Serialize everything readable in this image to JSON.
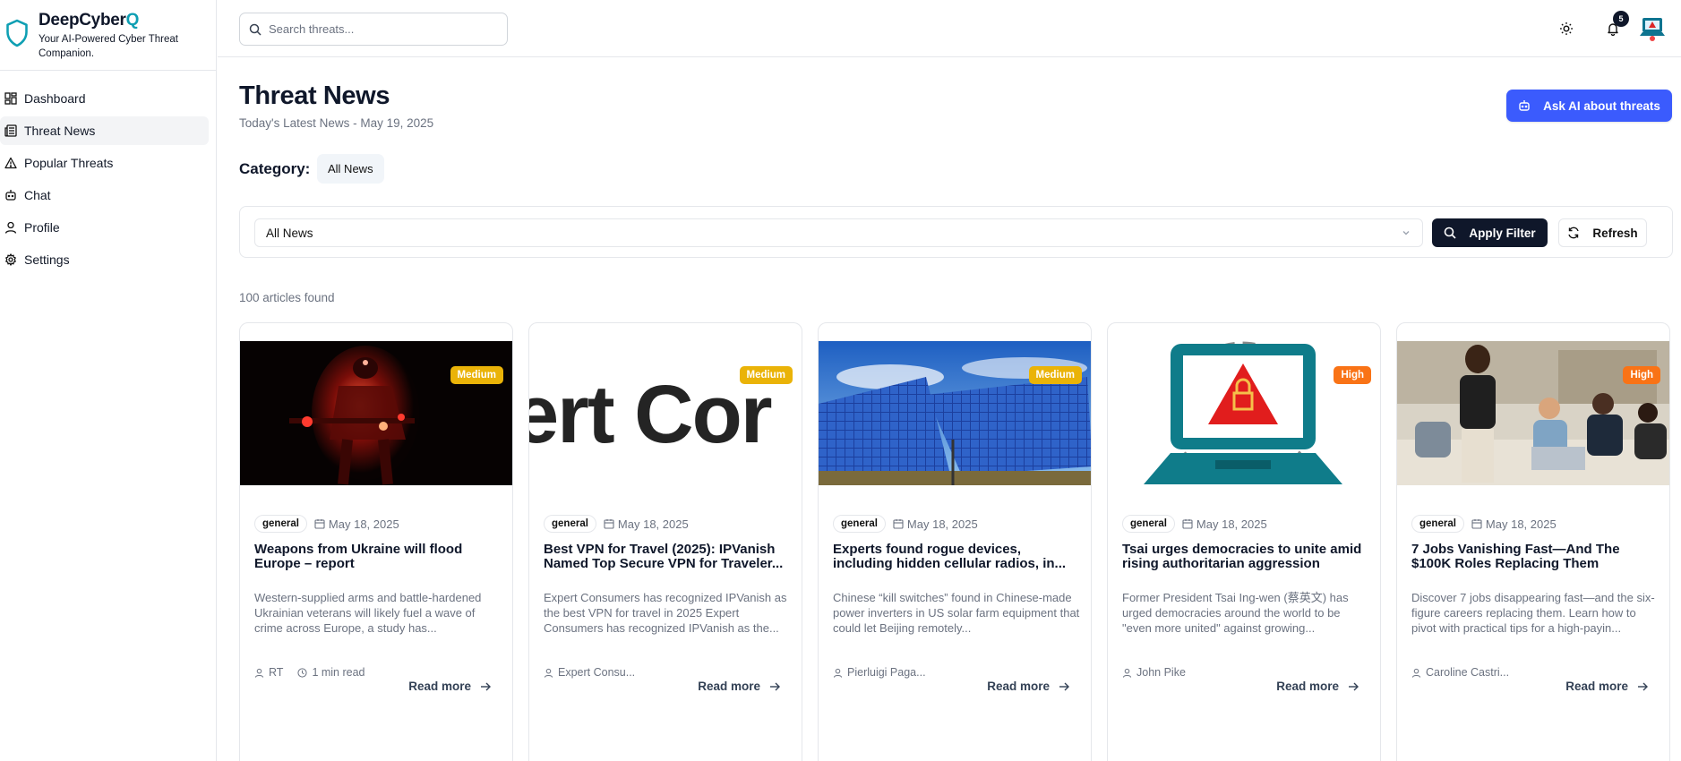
{
  "brand": {
    "name_main": "DeepCyber",
    "name_accent": "Q",
    "tagline": "Your AI-Powered Cyber Threat Companion.",
    "accent_color": "#0e9fb3"
  },
  "sidebar": {
    "items": [
      {
        "label": "Dashboard",
        "icon": "dashboard-icon"
      },
      {
        "label": "Threat News",
        "icon": "newspaper-icon",
        "active": true
      },
      {
        "label": "Popular Threats",
        "icon": "warning-triangle-icon"
      },
      {
        "label": "Chat",
        "icon": "bot-icon"
      },
      {
        "label": "Profile",
        "icon": "user-icon"
      },
      {
        "label": "Settings",
        "icon": "gear-icon"
      }
    ]
  },
  "header": {
    "search_placeholder": "Search threats...",
    "notification_count": "5"
  },
  "page": {
    "title": "Threat News",
    "subtitle": "Today's Latest News - May 19, 2025",
    "ask_ai_label": "Ask AI about threats",
    "category_label": "Category:",
    "category_chip": "All News"
  },
  "filter": {
    "selected": "All News",
    "apply_label": "Apply Filter",
    "refresh_label": "Refresh"
  },
  "results": {
    "count_text": "100 articles found"
  },
  "colors": {
    "primary_button": "#3b5bfd",
    "dark_button": "#0f172a",
    "medium": "#eab308",
    "high": "#f97316"
  },
  "articles": [
    {
      "severity": "Medium",
      "tag": "general",
      "date": "May 18, 2025",
      "title": "Weapons from Ukraine will flood Europe – report",
      "description": "Western-supplied arms and battle-hardened Ukrainian veterans will likely fuel a wave of crime across Europe, a study has...",
      "author": "RT",
      "read_time": "1 min read",
      "read_more": "Read more"
    },
    {
      "severity": "Medium",
      "tag": "general",
      "date": "May 18, 2025",
      "title": "Best VPN for Travel (2025): IPVanish Named Top Secure VPN for Traveler...",
      "description": "Expert Consumers has recognized IPVanish as the best VPN for travel in 2025 Expert Consumers has recognized IPVanish as the...",
      "author": "Expert Consu...",
      "read_more": "Read more",
      "image_text": "ert Cor"
    },
    {
      "severity": "Medium",
      "tag": "general",
      "date": "May 18, 2025",
      "title": "Experts found rogue devices, including hidden cellular radios, in...",
      "description": "Chinese “kill switches” found in Chinese-made power inverters in US solar farm equipment that could let Beijing remotely...",
      "author": "Pierluigi Paga...",
      "read_more": "Read more"
    },
    {
      "severity": "High",
      "tag": "general",
      "date": "May 18, 2025",
      "title": "Tsai urges democracies to unite amid rising authoritarian aggression",
      "description": "Former President Tsai Ing-wen (蔡英文) has urged democracies around the world to be \"even more united\" against growing...",
      "author": "John Pike",
      "read_more": "Read more"
    },
    {
      "severity": "High",
      "tag": "general",
      "date": "May 18, 2025",
      "title": "7 Jobs Vanishing Fast—And The $100K Roles Replacing Them",
      "description": "Discover 7 jobs disappearing fast—and the six-figure careers replacing them. Learn how to pivot with practical tips for a high-payin...",
      "author": "Caroline Castri...",
      "read_more": "Read more"
    }
  ]
}
